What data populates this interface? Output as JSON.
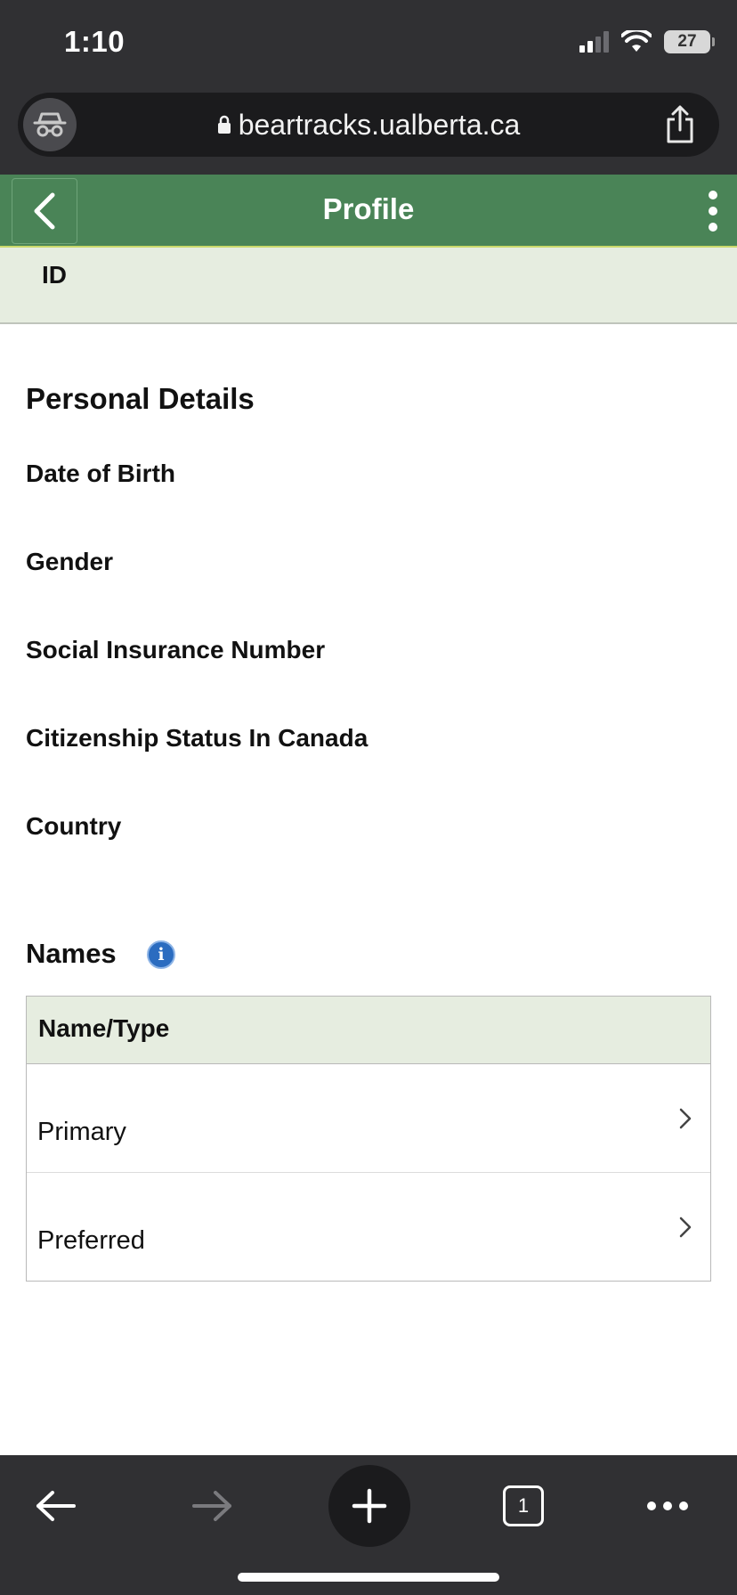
{
  "status_bar": {
    "time": "1:10",
    "battery": "27",
    "icons": [
      "signal-icon",
      "wifi-icon",
      "battery-icon"
    ]
  },
  "browser": {
    "url": "beartracks.ualberta.ca",
    "icons": [
      "incognito-icon",
      "lock-icon",
      "share-icon"
    ]
  },
  "header": {
    "title": "Profile",
    "icons": [
      "back-chevron-icon",
      "kebab-menu-icon"
    ]
  },
  "id_band": {
    "label": "ID"
  },
  "personal_details": {
    "title": "Personal Details",
    "fields": [
      {
        "label": "Date of Birth"
      },
      {
        "label": "Gender"
      },
      {
        "label": "Social Insurance Number"
      },
      {
        "label": "Citizenship Status In Canada"
      },
      {
        "label": "Country"
      }
    ]
  },
  "names": {
    "title": "Names",
    "info_icon": "i",
    "table_header": "Name/Type",
    "rows": [
      {
        "label": "Primary"
      },
      {
        "label": "Preferred"
      }
    ]
  },
  "toolbar": {
    "tab_count": "1",
    "icons": [
      "back-arrow-icon",
      "forward-arrow-icon",
      "plus-icon",
      "tabs-icon",
      "more-icon"
    ]
  },
  "colors": {
    "header_green": "#4a8457",
    "band_green": "#e6ede0",
    "chrome_dark": "#303033"
  }
}
